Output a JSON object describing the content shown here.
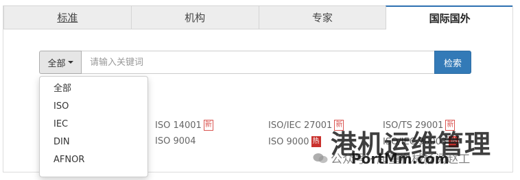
{
  "tabs": [
    {
      "label": "标准",
      "active": false,
      "underline": true
    },
    {
      "label": "机构",
      "active": false,
      "underline": false
    },
    {
      "label": "专家",
      "active": false,
      "underline": false
    },
    {
      "label": "国际国外",
      "active": true,
      "underline": false
    }
  ],
  "search": {
    "scope_label": "全部",
    "placeholder": "请输入关键词",
    "button_label": "检索"
  },
  "dropdown": {
    "options": [
      "全部",
      "ISO",
      "IEC",
      "DIN",
      "AFNOR"
    ]
  },
  "hot_standards": [
    {
      "code": "ISO 14001",
      "badge": "新"
    },
    {
      "code": "ISO/IEC 27001",
      "badge": "新"
    },
    {
      "code": "ISO/TS 29001",
      "badge": "新"
    },
    {
      "code": "ISO 9004",
      "badge": ""
    },
    {
      "code": "ISO 9000",
      "badge": "热"
    },
    {
      "code": "ISO/IEC 90003",
      "badge": "热"
    }
  ],
  "watermark": {
    "title": "港机运维管理",
    "subtitle": "公众号 · 起重机械杨阅赵工",
    "url": "PortMm.com"
  },
  "colors": {
    "accent": "#337ab7",
    "badge_red": "#c9302c",
    "tab_bg": "#ededed"
  }
}
